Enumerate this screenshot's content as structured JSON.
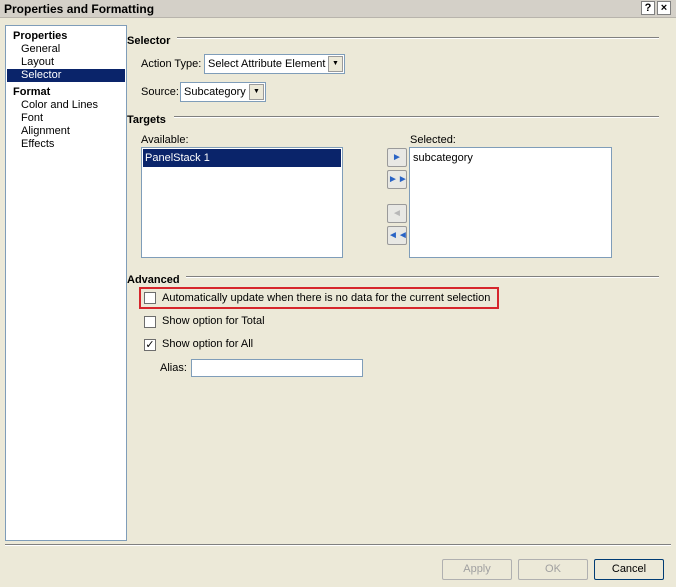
{
  "window": {
    "title": "Properties and Formatting",
    "help_label": "?",
    "close_label": "×"
  },
  "nav": {
    "groups": [
      {
        "label": "Properties",
        "items": [
          "General",
          "Layout",
          "Selector"
        ]
      },
      {
        "label": "Format",
        "items": [
          "Color and Lines",
          "Font",
          "Alignment",
          "Effects"
        ]
      }
    ],
    "selected": "Selector"
  },
  "selector": {
    "title": "Selector",
    "action_type_label": "Action Type:",
    "action_type_value": "Select Attribute Element",
    "source_label": "Source:",
    "source_value": "Subcategory"
  },
  "targets": {
    "title": "Targets",
    "available_label": "Available:",
    "available_items": [
      "PanelStack 1"
    ],
    "selected_label": "Selected:",
    "selected_items": [
      "subcategory"
    ]
  },
  "advanced": {
    "title": "Advanced",
    "auto_update_label": "Automatically update when there is no data for the current selection",
    "auto_update_checked": false,
    "show_total_label": "Show option for Total",
    "show_total_checked": false,
    "show_all_label": "Show option for All",
    "show_all_checked": true,
    "alias_label": "Alias:",
    "alias_value": ""
  },
  "footer": {
    "apply_label": "Apply",
    "ok_label": "OK",
    "cancel_label": "Cancel"
  },
  "colors": {
    "selection": "#0a246a",
    "highlight": "#d6262c",
    "arrow": "#2a64c5"
  },
  "icons": {
    "move_right": "arrow-right-icon",
    "move_all_right": "double-arrow-right-icon",
    "move_left": "arrow-left-icon",
    "move_all_left": "double-arrow-left-icon",
    "dropdown": "chevron-down-icon",
    "check": "checkmark-icon"
  }
}
